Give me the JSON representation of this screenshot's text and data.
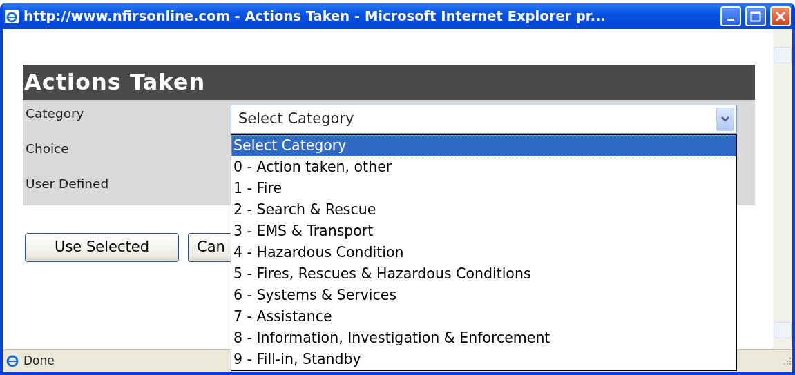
{
  "window": {
    "title": "http://www.nfirsonline.com - Actions Taken - Microsoft Internet Explorer pr..."
  },
  "form": {
    "heading": "Actions Taken",
    "fields": [
      {
        "label": "Category"
      },
      {
        "label": "Choice"
      },
      {
        "label": "User Defined"
      }
    ],
    "category_select": {
      "value": "Select Category",
      "expanded": true
    }
  },
  "buttons": [
    "Use Selected",
    "Can"
  ],
  "dropdown": {
    "options": [
      {
        "label": "Select Category",
        "selected": true
      },
      {
        "label": "0 - Action taken, other",
        "selected": false
      },
      {
        "label": "1 - Fire",
        "selected": false
      },
      {
        "label": "2 - Search & Rescue",
        "selected": false
      },
      {
        "label": "3 - EMS & Transport",
        "selected": false
      },
      {
        "label": "4 - Hazardous Condition",
        "selected": false
      },
      {
        "label": "5 - Fires, Rescues & Hazardous Conditions",
        "selected": false
      },
      {
        "label": "6 - Systems & Services",
        "selected": false
      },
      {
        "label": "7 - Assistance",
        "selected": false
      },
      {
        "label": "8 - Information, Investigation & Enforcement",
        "selected": false
      },
      {
        "label": "9 - Fill-in, Standby",
        "selected": false
      }
    ]
  },
  "status_bar": {
    "text": "Done"
  }
}
